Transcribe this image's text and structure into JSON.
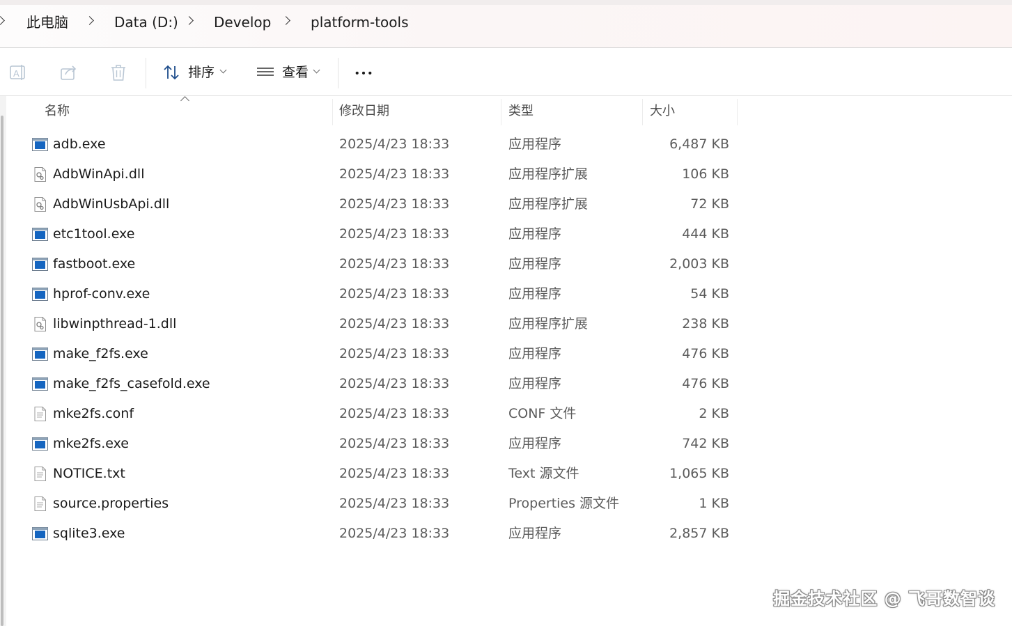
{
  "breadcrumb": {
    "items": [
      "此电脑",
      "Data (D:)",
      "Develop",
      "platform-tools"
    ]
  },
  "toolbar": {
    "sort_label": "排序",
    "view_label": "查看",
    "more_icon": "more-icon",
    "icons": [
      "rename-icon",
      "share-icon",
      "delete-icon",
      "sort-icon",
      "view-icon"
    ]
  },
  "columns": {
    "name": "名称",
    "date": "修改日期",
    "type": "类型",
    "size": "大小"
  },
  "files": [
    {
      "name": "adb.exe",
      "date": "2025/4/23 18:33",
      "type": "应用程序",
      "size": "6,487 KB",
      "icon": "exe-icon"
    },
    {
      "name": "AdbWinApi.dll",
      "date": "2025/4/23 18:33",
      "type": "应用程序扩展",
      "size": "106 KB",
      "icon": "dll-icon"
    },
    {
      "name": "AdbWinUsbApi.dll",
      "date": "2025/4/23 18:33",
      "type": "应用程序扩展",
      "size": "72 KB",
      "icon": "dll-icon"
    },
    {
      "name": "etc1tool.exe",
      "date": "2025/4/23 18:33",
      "type": "应用程序",
      "size": "444 KB",
      "icon": "exe-icon"
    },
    {
      "name": "fastboot.exe",
      "date": "2025/4/23 18:33",
      "type": "应用程序",
      "size": "2,003 KB",
      "icon": "exe-icon"
    },
    {
      "name": "hprof-conv.exe",
      "date": "2025/4/23 18:33",
      "type": "应用程序",
      "size": "54 KB",
      "icon": "exe-icon"
    },
    {
      "name": "libwinpthread-1.dll",
      "date": "2025/4/23 18:33",
      "type": "应用程序扩展",
      "size": "238 KB",
      "icon": "dll-icon"
    },
    {
      "name": "make_f2fs.exe",
      "date": "2025/4/23 18:33",
      "type": "应用程序",
      "size": "476 KB",
      "icon": "exe-icon"
    },
    {
      "name": "make_f2fs_casefold.exe",
      "date": "2025/4/23 18:33",
      "type": "应用程序",
      "size": "476 KB",
      "icon": "exe-icon"
    },
    {
      "name": "mke2fs.conf",
      "date": "2025/4/23 18:33",
      "type": "CONF 文件",
      "size": "2 KB",
      "icon": "text-file-icon"
    },
    {
      "name": "mke2fs.exe",
      "date": "2025/4/23 18:33",
      "type": "应用程序",
      "size": "742 KB",
      "icon": "exe-icon"
    },
    {
      "name": "NOTICE.txt",
      "date": "2025/4/23 18:33",
      "type": "Text 源文件",
      "size": "1,065 KB",
      "icon": "text-file-icon"
    },
    {
      "name": "source.properties",
      "date": "2025/4/23 18:33",
      "type": "Properties 源文件",
      "size": "1 KB",
      "icon": "text-file-icon"
    },
    {
      "name": "sqlite3.exe",
      "date": "2025/4/23 18:33",
      "type": "应用程序",
      "size": "2,857 KB",
      "icon": "exe-icon"
    }
  ],
  "watermark": "掘金技术社区 @ 飞哥数智谈"
}
